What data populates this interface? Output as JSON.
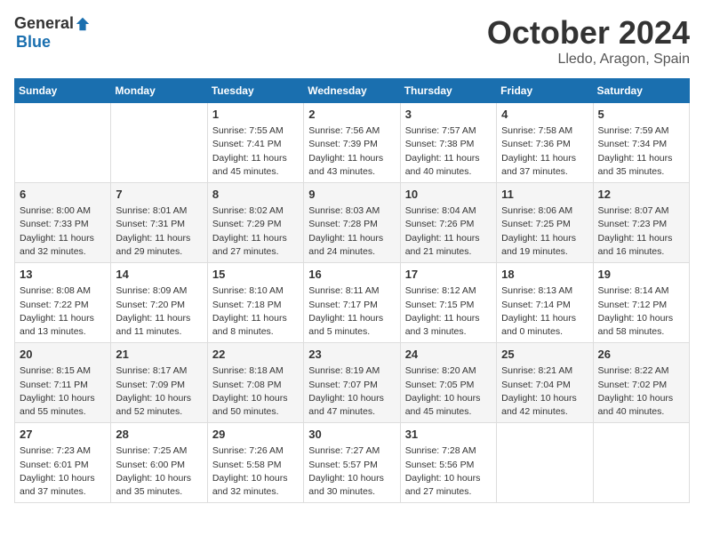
{
  "logo": {
    "general": "General",
    "blue": "Blue"
  },
  "header": {
    "month": "October 2024",
    "location": "Lledo, Aragon, Spain"
  },
  "weekdays": [
    "Sunday",
    "Monday",
    "Tuesday",
    "Wednesday",
    "Thursday",
    "Friday",
    "Saturday"
  ],
  "weeks": [
    [
      {
        "day": "",
        "content": ""
      },
      {
        "day": "",
        "content": ""
      },
      {
        "day": "1",
        "content": "Sunrise: 7:55 AM\nSunset: 7:41 PM\nDaylight: 11 hours and 45 minutes."
      },
      {
        "day": "2",
        "content": "Sunrise: 7:56 AM\nSunset: 7:39 PM\nDaylight: 11 hours and 43 minutes."
      },
      {
        "day": "3",
        "content": "Sunrise: 7:57 AM\nSunset: 7:38 PM\nDaylight: 11 hours and 40 minutes."
      },
      {
        "day": "4",
        "content": "Sunrise: 7:58 AM\nSunset: 7:36 PM\nDaylight: 11 hours and 37 minutes."
      },
      {
        "day": "5",
        "content": "Sunrise: 7:59 AM\nSunset: 7:34 PM\nDaylight: 11 hours and 35 minutes."
      }
    ],
    [
      {
        "day": "6",
        "content": "Sunrise: 8:00 AM\nSunset: 7:33 PM\nDaylight: 11 hours and 32 minutes."
      },
      {
        "day": "7",
        "content": "Sunrise: 8:01 AM\nSunset: 7:31 PM\nDaylight: 11 hours and 29 minutes."
      },
      {
        "day": "8",
        "content": "Sunrise: 8:02 AM\nSunset: 7:29 PM\nDaylight: 11 hours and 27 minutes."
      },
      {
        "day": "9",
        "content": "Sunrise: 8:03 AM\nSunset: 7:28 PM\nDaylight: 11 hours and 24 minutes."
      },
      {
        "day": "10",
        "content": "Sunrise: 8:04 AM\nSunset: 7:26 PM\nDaylight: 11 hours and 21 minutes."
      },
      {
        "day": "11",
        "content": "Sunrise: 8:06 AM\nSunset: 7:25 PM\nDaylight: 11 hours and 19 minutes."
      },
      {
        "day": "12",
        "content": "Sunrise: 8:07 AM\nSunset: 7:23 PM\nDaylight: 11 hours and 16 minutes."
      }
    ],
    [
      {
        "day": "13",
        "content": "Sunrise: 8:08 AM\nSunset: 7:22 PM\nDaylight: 11 hours and 13 minutes."
      },
      {
        "day": "14",
        "content": "Sunrise: 8:09 AM\nSunset: 7:20 PM\nDaylight: 11 hours and 11 minutes."
      },
      {
        "day": "15",
        "content": "Sunrise: 8:10 AM\nSunset: 7:18 PM\nDaylight: 11 hours and 8 minutes."
      },
      {
        "day": "16",
        "content": "Sunrise: 8:11 AM\nSunset: 7:17 PM\nDaylight: 11 hours and 5 minutes."
      },
      {
        "day": "17",
        "content": "Sunrise: 8:12 AM\nSunset: 7:15 PM\nDaylight: 11 hours and 3 minutes."
      },
      {
        "day": "18",
        "content": "Sunrise: 8:13 AM\nSunset: 7:14 PM\nDaylight: 11 hours and 0 minutes."
      },
      {
        "day": "19",
        "content": "Sunrise: 8:14 AM\nSunset: 7:12 PM\nDaylight: 10 hours and 58 minutes."
      }
    ],
    [
      {
        "day": "20",
        "content": "Sunrise: 8:15 AM\nSunset: 7:11 PM\nDaylight: 10 hours and 55 minutes."
      },
      {
        "day": "21",
        "content": "Sunrise: 8:17 AM\nSunset: 7:09 PM\nDaylight: 10 hours and 52 minutes."
      },
      {
        "day": "22",
        "content": "Sunrise: 8:18 AM\nSunset: 7:08 PM\nDaylight: 10 hours and 50 minutes."
      },
      {
        "day": "23",
        "content": "Sunrise: 8:19 AM\nSunset: 7:07 PM\nDaylight: 10 hours and 47 minutes."
      },
      {
        "day": "24",
        "content": "Sunrise: 8:20 AM\nSunset: 7:05 PM\nDaylight: 10 hours and 45 minutes."
      },
      {
        "day": "25",
        "content": "Sunrise: 8:21 AM\nSunset: 7:04 PM\nDaylight: 10 hours and 42 minutes."
      },
      {
        "day": "26",
        "content": "Sunrise: 8:22 AM\nSunset: 7:02 PM\nDaylight: 10 hours and 40 minutes."
      }
    ],
    [
      {
        "day": "27",
        "content": "Sunrise: 7:23 AM\nSunset: 6:01 PM\nDaylight: 10 hours and 37 minutes."
      },
      {
        "day": "28",
        "content": "Sunrise: 7:25 AM\nSunset: 6:00 PM\nDaylight: 10 hours and 35 minutes."
      },
      {
        "day": "29",
        "content": "Sunrise: 7:26 AM\nSunset: 5:58 PM\nDaylight: 10 hours and 32 minutes."
      },
      {
        "day": "30",
        "content": "Sunrise: 7:27 AM\nSunset: 5:57 PM\nDaylight: 10 hours and 30 minutes."
      },
      {
        "day": "31",
        "content": "Sunrise: 7:28 AM\nSunset: 5:56 PM\nDaylight: 10 hours and 27 minutes."
      },
      {
        "day": "",
        "content": ""
      },
      {
        "day": "",
        "content": ""
      }
    ]
  ]
}
